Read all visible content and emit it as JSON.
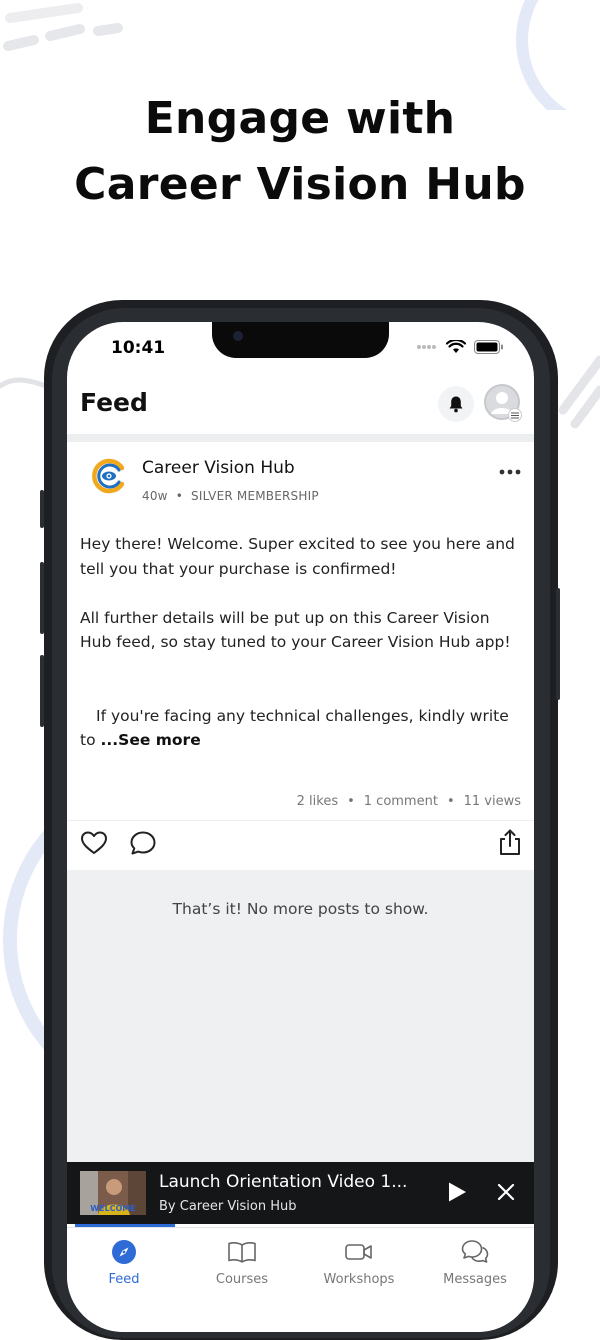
{
  "promo": {
    "headline_line1": "Engage with",
    "headline_line2": "Career Vision Hub"
  },
  "status_bar": {
    "time": "10:41"
  },
  "header": {
    "title": "Feed",
    "notification_icon": "bell-icon",
    "profile_icon": "avatar-icon"
  },
  "post": {
    "author": "Career Vision Hub",
    "age": "40w",
    "membership": "SILVER MEMBERSHIP",
    "paragraph1": "Hey there! Welcome. Super excited to see you here and tell you that your purchase is confirmed!",
    "paragraph2": "All further details will be put up on this Career Vision Hub feed, so stay tuned to your Career Vision Hub app!",
    "paragraph3": "If you're facing any technical challenges, kindly write to",
    "see_more": "...See more",
    "likes": "2 likes",
    "comments": "1 comment",
    "views": "11 views"
  },
  "feed_end": {
    "message": "That’s it! No more posts to show."
  },
  "mini_player": {
    "title": "Launch Orientation Video 1...",
    "byline": "By Career Vision Hub",
    "thumb_caption": "WELCOME"
  },
  "tabs": [
    {
      "label": "Feed",
      "icon": "compass-icon",
      "active": true
    },
    {
      "label": "Courses",
      "icon": "book-icon",
      "active": false
    },
    {
      "label": "Workshops",
      "icon": "video-camera-icon",
      "active": false
    },
    {
      "label": "Messages",
      "icon": "chat-bubbles-icon",
      "active": false
    }
  ],
  "colors": {
    "accent": "#2f6bd6",
    "player_bg": "#151618"
  }
}
